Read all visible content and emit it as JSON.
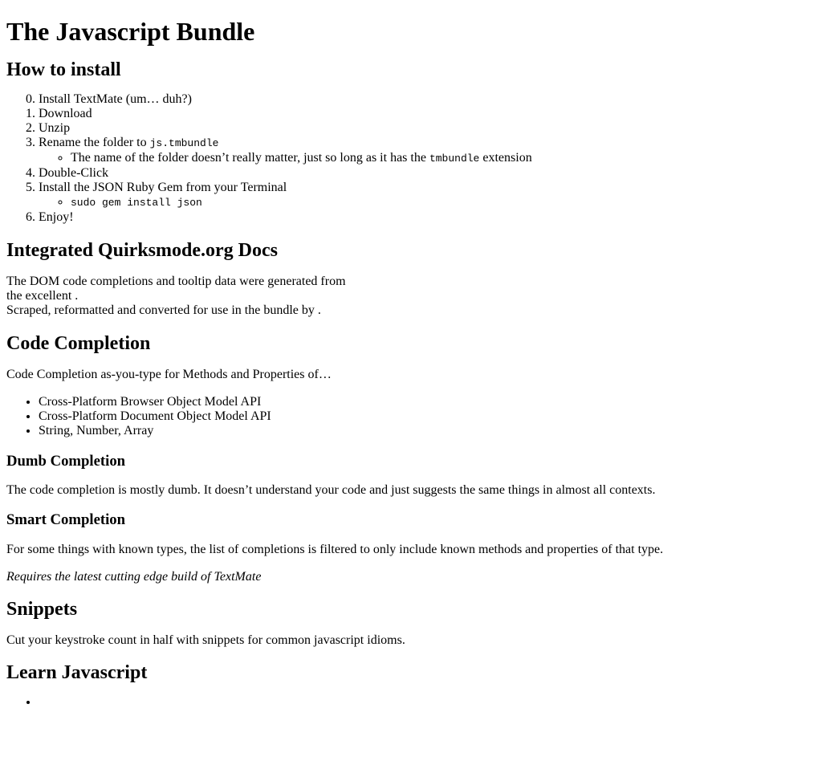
{
  "title": "The Javascript Bundle",
  "install": {
    "heading": "How to install",
    "steps": [
      {
        "num": "0.",
        "text": "Install TextMate (um… duh?)"
      },
      {
        "num": "1.",
        "text": "Download"
      },
      {
        "num": "2.",
        "text": "Unzip"
      },
      {
        "num": "3.",
        "text": "Rename the folder to ",
        "code": "js.tmbundle",
        "sub": {
          "before": "The name of the folder doesn’t really matter, just so long as it has the ",
          "code": "tmbundle",
          "after": " extension"
        }
      },
      {
        "num": "4.",
        "text": "Double-Click"
      },
      {
        "num": "5.",
        "text": "Install the JSON Ruby Gem from your Terminal",
        "sub": {
          "code": "sudo gem install json"
        }
      },
      {
        "num": "6.",
        "text": "Enjoy!"
      }
    ]
  },
  "quirks": {
    "heading": "Integrated Quirksmode.org Docs",
    "line1": "The DOM code completions and tooltip data were generated from",
    "line2": "the excellent .",
    "line3": "Scraped, reformatted and converted for use in the bundle by ."
  },
  "completion": {
    "heading": "Code Completion",
    "intro": "Code Completion as-you-type for Methods and Properties of…",
    "items": [
      "Cross-Platform Browser Object Model API",
      "Cross-Platform Document Object Model API",
      "String, Number, Array"
    ],
    "dumb": {
      "heading": "Dumb Completion",
      "text": "The code completion is mostly dumb. It doesn’t understand your code and just suggests the same things in almost all contexts."
    },
    "smart": {
      "heading": "Smart Completion",
      "text": "For some things with known types, the list of completions is filtered to only include known methods and properties of that type.",
      "note": "Requires the latest cutting edge build of TextMate"
    }
  },
  "snippets": {
    "heading": "Snippets",
    "text": "Cut your keystroke count in half with snippets for common javascript idioms."
  },
  "learn": {
    "heading": "Learn Javascript"
  }
}
